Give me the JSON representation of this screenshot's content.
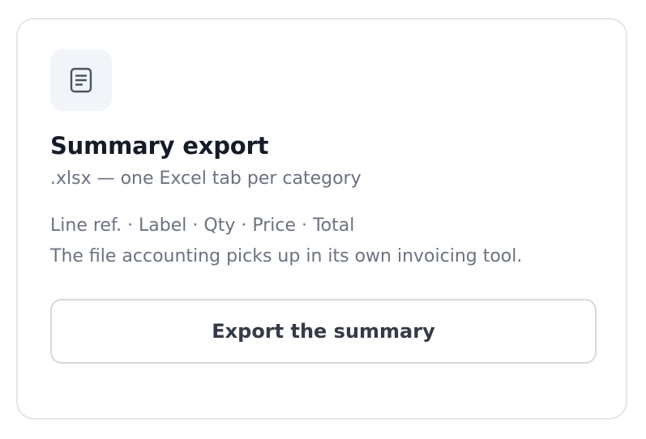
{
  "card": {
    "icon": "document-icon",
    "title": "Summary export",
    "subtitle": ".xlsx — one Excel tab per category",
    "columns": "Line ref. · Label · Qty · Price · Total",
    "description": "The file accounting picks up in its own invoicing tool.",
    "button_label": "Export the summary"
  },
  "colors": {
    "title": "#151b27",
    "muted_text": "#6b7280",
    "icon_tile_bg": "#f1f4f8",
    "icon_stroke": "#4b5563",
    "border": "#e4e6ea"
  }
}
